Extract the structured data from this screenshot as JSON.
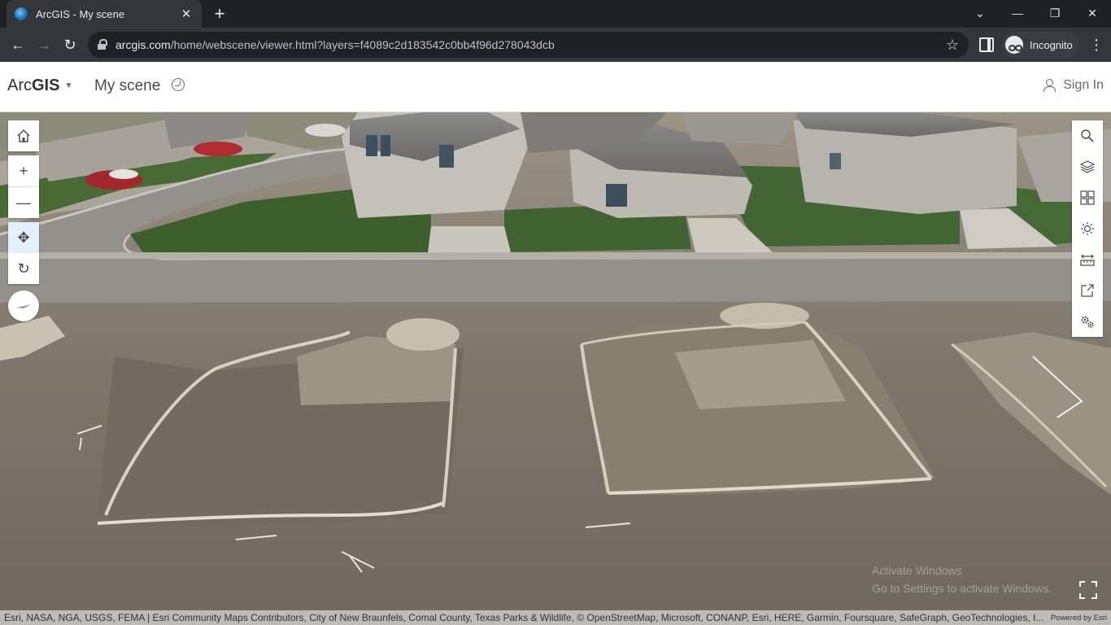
{
  "browser": {
    "tab_title": "ArcGIS - My scene",
    "tab_close": "✕",
    "new_tab": "+",
    "url_host": "arcgis.com",
    "url_path": "/home/webscene/viewer.html?layers=f4089c2d183542c0bb4f96d278043dcb",
    "incognito_label": "Incognito",
    "controls": {
      "tab_search": "⌄",
      "minimize": "—",
      "restore": "❐",
      "close": "✕",
      "back": "←",
      "forward": "→",
      "reload": "↻",
      "bookmark": "☆",
      "menu": "⋮"
    }
  },
  "app": {
    "brand_prefix": "Arc",
    "brand_bold": "GIS",
    "brand_caret": "▼",
    "scene_title": "My scene",
    "sign_in": "Sign In"
  },
  "left_widgets": [
    {
      "name": "home-icon"
    },
    {
      "name": "zoom-in-icon",
      "glyph": "+"
    },
    {
      "name": "zoom-out-icon",
      "glyph": "—"
    },
    {
      "name": "pan-icon",
      "glyph": "✥",
      "active": true
    },
    {
      "name": "rotate-icon",
      "glyph": "↻"
    },
    {
      "name": "compass-icon"
    }
  ],
  "right_widgets": [
    {
      "name": "search-icon"
    },
    {
      "name": "layers-icon"
    },
    {
      "name": "basemap-gallery-icon"
    },
    {
      "name": "daylight-icon"
    },
    {
      "name": "measure-icon"
    },
    {
      "name": "share-icon"
    },
    {
      "name": "settings-icon"
    }
  ],
  "watermark": {
    "line1": "Activate Windows",
    "line2": "Go to Settings to activate Windows."
  },
  "attribution": {
    "text": "Esri, NASA, NGA, USGS, FEMA | Esri Community Maps Contributors, City of New Braunfels, Comal County, Texas Parks & Wildlife, © OpenStreetMap, Microsoft, CONANP, Esri, HERE, Garmin, Foursquare, SafeGraph, GeoTechnologies, I...",
    "powered_by": "Powered by Esri"
  },
  "colors": {
    "chrome_dark": "#202124",
    "chrome_toolbar": "#35363a",
    "accent_active": "#e2f1fb",
    "text_dark": "#323232"
  }
}
